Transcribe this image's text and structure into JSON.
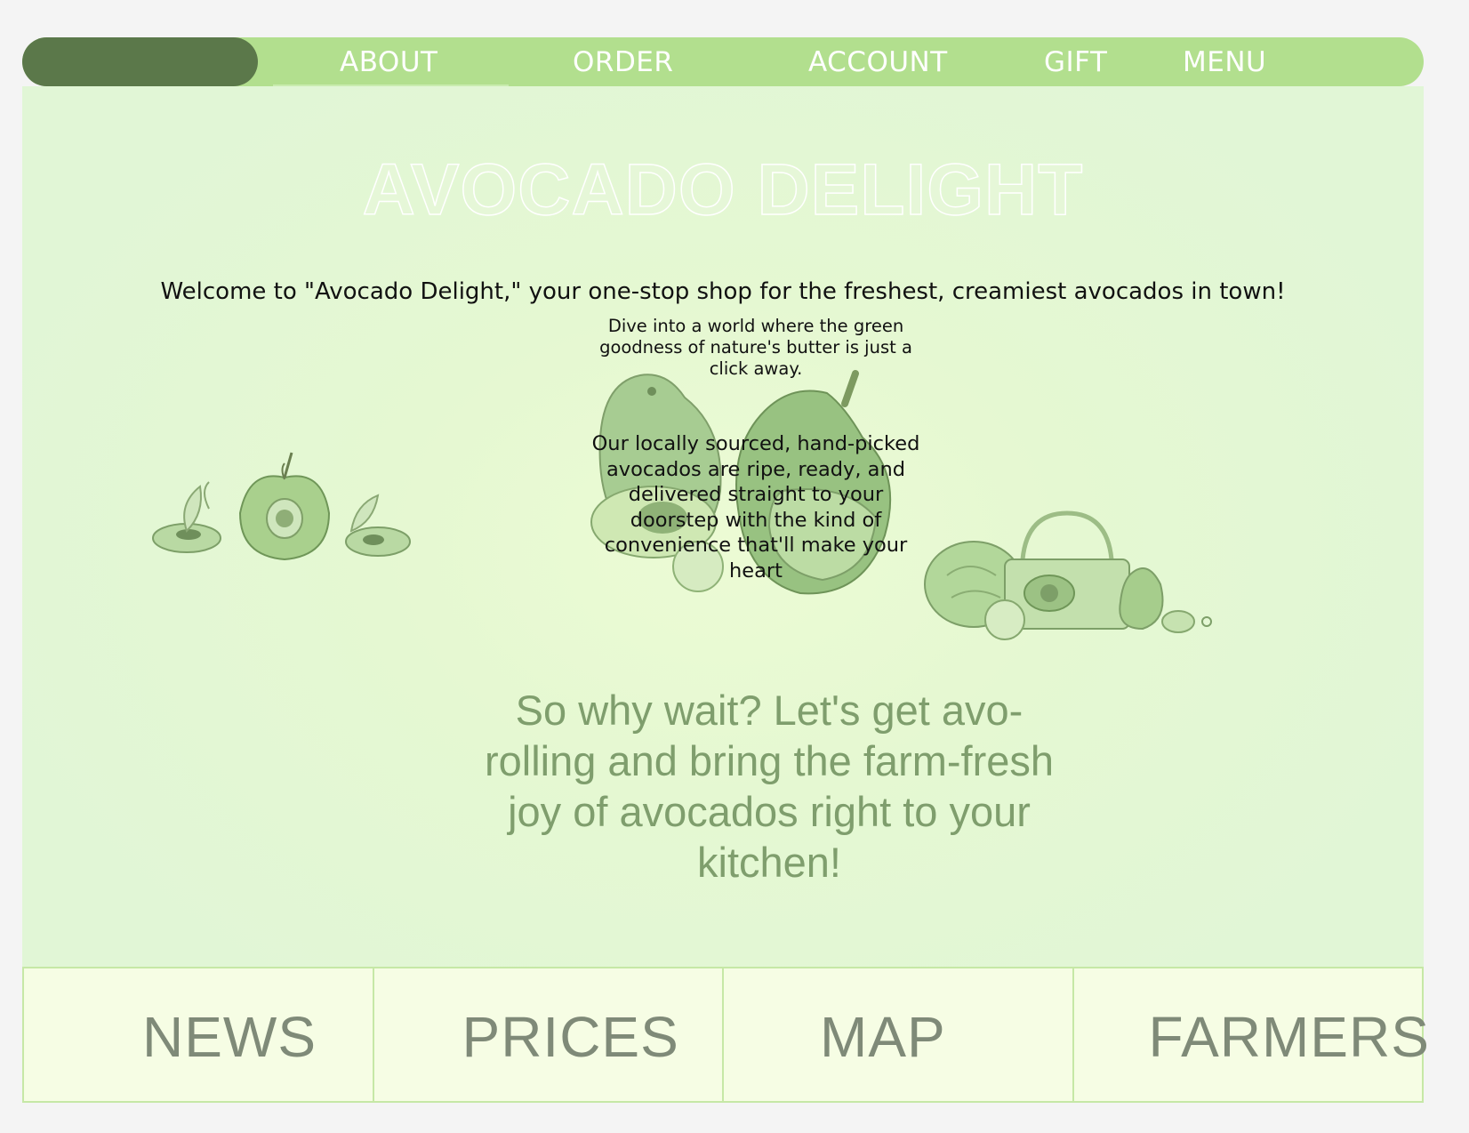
{
  "nav": {
    "items": [
      {
        "label": "ABOUT"
      },
      {
        "label": "ORDER"
      },
      {
        "label": "ACCOUNT"
      },
      {
        "label": "GIFT"
      },
      {
        "label": "MENU"
      }
    ]
  },
  "hero": {
    "title": "AVOCADO DELIGHT",
    "welcome": "Welcome to \"Avocado Delight,\" your one-stop shop for the freshest, creamiest avocados in town!",
    "dive": "Dive into a world where the green goodness of nature's butter is just a click away.",
    "local": "Our locally sourced, hand-picked avocados are ripe, ready, and delivered straight to your doorstep with the kind of convenience that'll make your heart",
    "cta": "So why wait? Let's get avo-rolling and bring the farm-fresh joy of avocados right to your kitchen!"
  },
  "tiles": [
    {
      "label": "NEWS"
    },
    {
      "label": "PRICES"
    },
    {
      "label": "MAP"
    },
    {
      "label": "FARMERS"
    }
  ],
  "colors": {
    "nav_bg": "#b2df8e",
    "brand_pill": "#5b784a",
    "main_bg": "#e5f8d2",
    "tile_bg": "#f6fde4",
    "cta_text": "#7f9e6d"
  }
}
